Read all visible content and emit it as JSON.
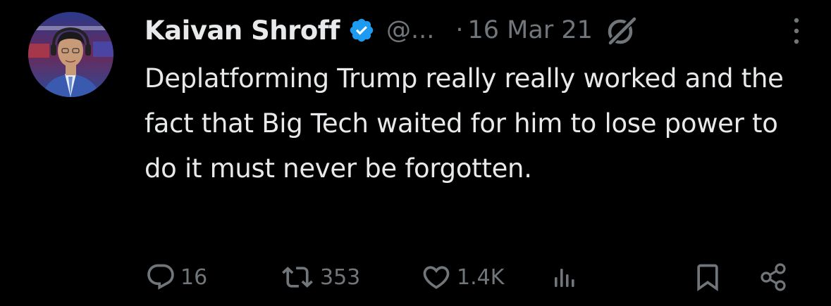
{
  "tweet": {
    "author": {
      "display_name": "Kaivan Shroff",
      "handle": "@...",
      "verified": true,
      "avatar_icon": "profile-photo"
    },
    "separator": "·",
    "date": "16 Mar 21",
    "text": "Deplatforming Trump really really worked and the fact that Big Tech waited for him to lose power to do it must never be forgotten.",
    "actions": {
      "replies": "16",
      "retweets": "353",
      "likes": "1.4K"
    }
  },
  "icons": {
    "verified": "verified-badge-icon",
    "grok": "grok-icon",
    "more": "more-icon",
    "reply": "reply-icon",
    "retweet": "retweet-icon",
    "like": "like-icon",
    "views": "views-icon",
    "bookmark": "bookmark-icon",
    "share": "share-icon"
  },
  "colors": {
    "background": "#000000",
    "text": "#e7e9ea",
    "secondary": "#71767b",
    "verified": "#1d9bf0"
  }
}
